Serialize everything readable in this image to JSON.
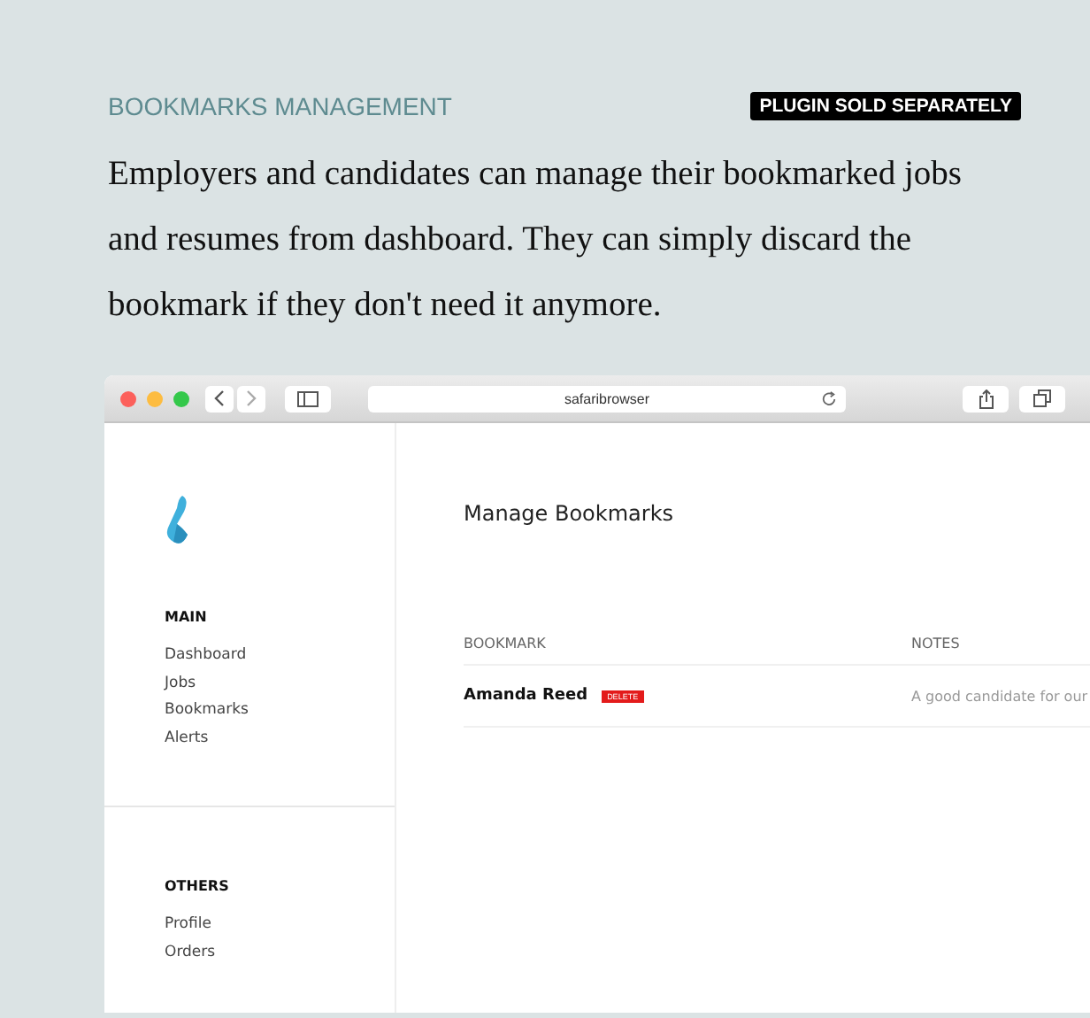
{
  "heading": "BOOKMARKS MANAGEMENT",
  "badge": "PLUGIN SOLD SEPARATELY",
  "description": "Employers and candidates can manage their bookmarked jobs and resumes from dashboard. They can simply discard the bookmark if they don't need it anymore.",
  "browser": {
    "address": "safaribrowser"
  },
  "sidebar": {
    "sections": [
      {
        "title": "MAIN",
        "items": [
          "Dashboard",
          "Jobs",
          "Bookmarks",
          "Alerts"
        ]
      },
      {
        "title": "OTHERS",
        "items": [
          "Profile",
          "Orders"
        ]
      }
    ]
  },
  "page_title": "Manage Bookmarks",
  "table": {
    "columns": [
      "BOOKMARK",
      "NOTES"
    ],
    "rows": [
      {
        "name": "Amanda Reed",
        "action": "DELETE",
        "notes": "A good candidate for our"
      }
    ]
  }
}
